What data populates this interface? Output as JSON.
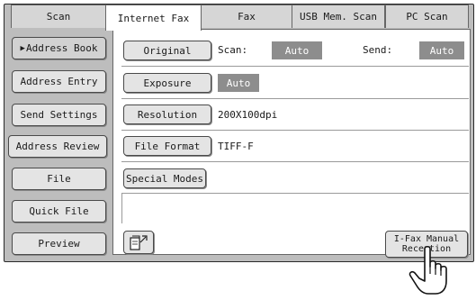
{
  "tabs": {
    "scan": "Scan",
    "internet_fax": "Internet Fax",
    "fax": "Fax",
    "usb_mem_scan": "USB Mem. Scan",
    "pc_scan": "PC Scan"
  },
  "sidebar": {
    "address_book": "Address Book",
    "address_entry": "Address Entry",
    "send_settings": "Send Settings",
    "address_review": "Address Review",
    "file": "File",
    "quick_file": "Quick File",
    "preview": "Preview"
  },
  "settings": {
    "original_button": "Original",
    "scan_label": "Scan:",
    "scan_value": "Auto",
    "send_label": "Send:",
    "send_value": "Auto",
    "exposure_button": "Exposure",
    "exposure_value": "Auto",
    "resolution_button": "Resolution",
    "resolution_value": "200X100dpi",
    "file_format_button": "File Format",
    "file_format_value": "TIFF-F",
    "special_modes_button": "Special Modes"
  },
  "bottom": {
    "ifax_line1": "I-Fax Manual",
    "ifax_line2": "Reception"
  },
  "icons": {
    "page_rotate": "page-rotate-icon",
    "pointer": "pointing-hand-icon"
  }
}
